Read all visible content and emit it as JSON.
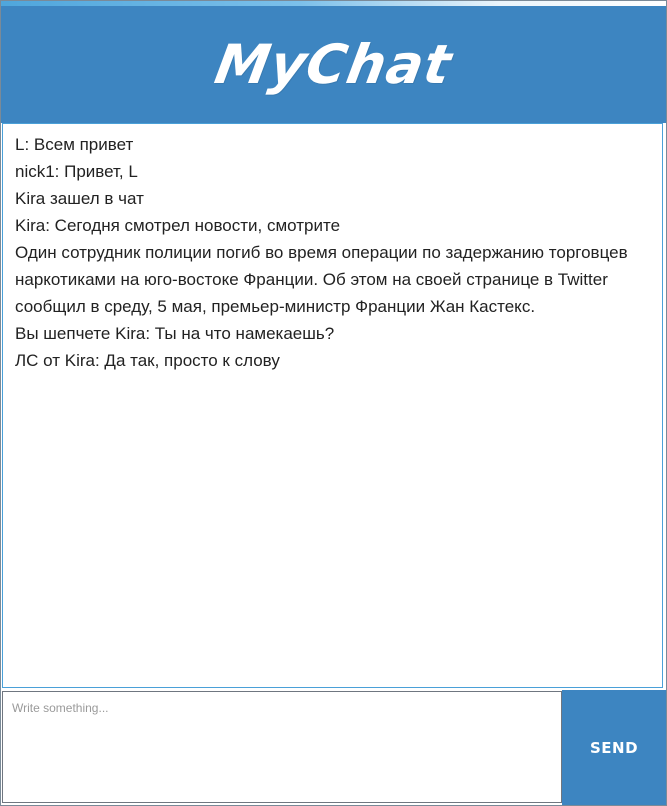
{
  "header": {
    "title": "MyChat"
  },
  "messages": [
    "L: Всем привет",
    "nick1: Привет, L",
    "Kira зашел в чат",
    "Kira: Сегодня смотрел новости, смотрите",
    "Один сотрудник полиции погиб во время операции по задержанию торговцев наркотиками на юго-востоке Франции. Об этом на своей странице в Twitter сообщил в среду, 5 мая, премьер-министр Франции Жан Кастекс.",
    "Вы шепчете Kira: Ты на что намекаешь?",
    "ЛС от Kira: Да так, просто к слову"
  ],
  "composer": {
    "input_value": "",
    "input_placeholder": "Write something...",
    "send_label": "SEND"
  },
  "colors": {
    "accent": "#3d85c1",
    "border": "#4aa0d8"
  }
}
